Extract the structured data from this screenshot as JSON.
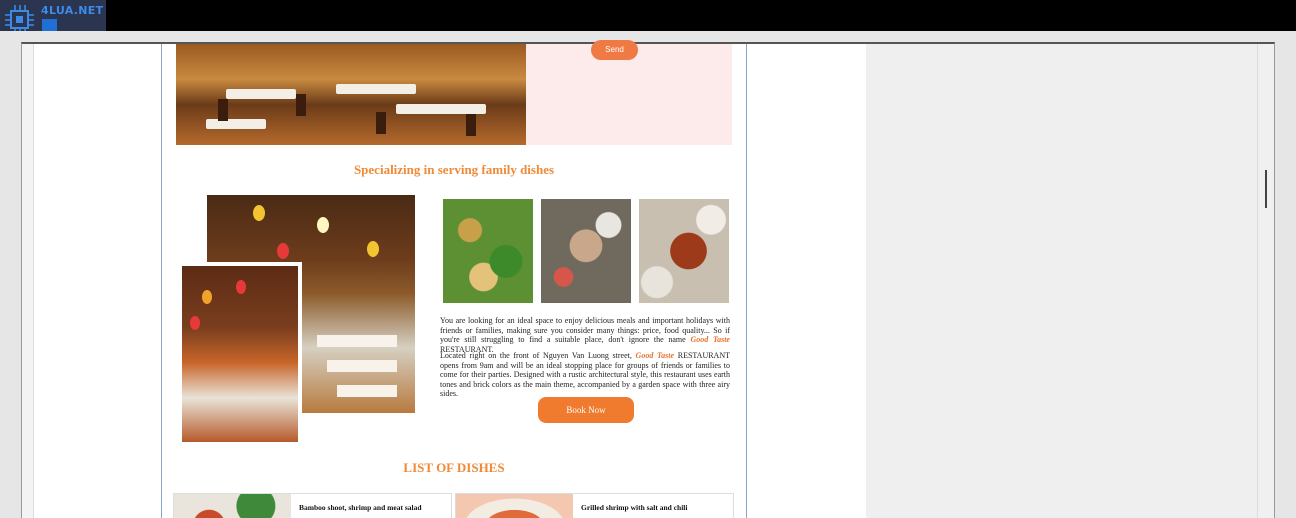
{
  "watermark": {
    "text": "4LUA.NET"
  },
  "contact": {
    "send_label": "Send"
  },
  "intro": {
    "title": "Specializing in serving family dishes",
    "paragraph1_before": "You are looking for an ideal space to enjoy delicious meals and important holidays with friends or families, making sure you consider many things: price, food quality... So if you're still struggling to find a suitable place, don't ignore the name ",
    "brand": "Good Taste",
    "paragraph1_after": " RESTAURANT.",
    "paragraph2_before": "Located right on the front of Nguyen Van Luong street, ",
    "paragraph2_after": " RESTAURANT opens from 9am and will be an ideal stopping place for groups of friends or families to come for their parties. Designed with a rustic architectural style, this restaurant uses earth tones and brick colors as the main theme, accompanied by a garden space with three airy sides.",
    "book_label": "Book Now"
  },
  "dishes": {
    "title": "LIST OF DISHES",
    "items": [
      {
        "name": "Bamboo shoot, shrimp and meat salad"
      },
      {
        "name": "Grilled shrimp with salt and chili"
      }
    ]
  },
  "colors": {
    "accent": "#f07a2d",
    "title": "#ee8a38",
    "contact_bg": "#fdeaea"
  }
}
